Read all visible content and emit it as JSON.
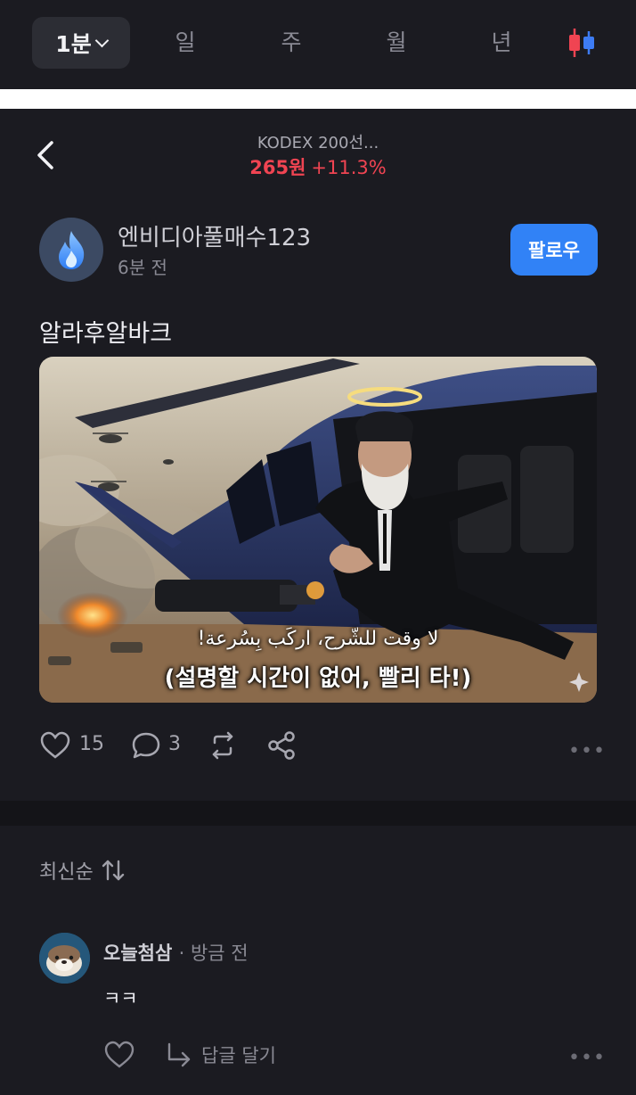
{
  "periods": {
    "selected": "1분",
    "tabs": [
      "일",
      "주",
      "월",
      "년"
    ],
    "chart_icon": "candlestick-icon"
  },
  "stock": {
    "name": "KODEX 200선...",
    "price": "265원",
    "change": "+11.3%",
    "change_color": "#f04452"
  },
  "post": {
    "author": "엔비디아풀매수123",
    "time": "6분 전",
    "follow_label": "팔로우",
    "title": "알라후알바크",
    "image_caption_arabic": "لا وقت للشّرح، اركَب بِسُرعة!",
    "image_caption_korean": "(설명할 시간이 없어, 빨리 타!)",
    "likes": "15",
    "comments": "3",
    "more": "•••"
  },
  "comments_section": {
    "sort_label": "최신순",
    "items": [
      {
        "author": "오늘첨삼",
        "time": "· 방금 전",
        "text": "ㅋㅋ",
        "reply_label": "답글 달기",
        "more": "•••"
      }
    ]
  },
  "colors": {
    "background": "#17171c",
    "accent": "#3182f6",
    "up": "#f04452"
  }
}
